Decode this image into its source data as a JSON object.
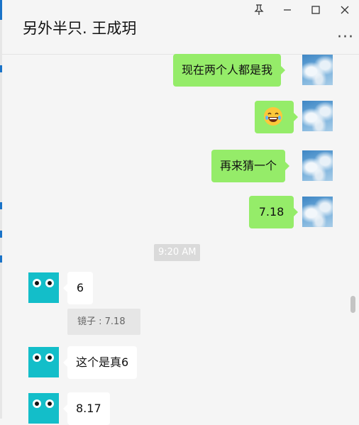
{
  "window": {
    "title": "另外半只. 王成玥",
    "more_label": "···"
  },
  "messages": [
    {
      "side": "right",
      "text": "现在两个人都是我"
    },
    {
      "side": "right",
      "emoji": "laughing-tears"
    },
    {
      "side": "right",
      "text": "再来猜一个"
    },
    {
      "side": "right",
      "text": "7.18"
    },
    {
      "side": "left",
      "text": "6"
    },
    {
      "side": "left",
      "text": "这个是真6"
    },
    {
      "side": "left",
      "text": "8.17"
    }
  ],
  "timestamp": "9:20 AM",
  "quote": {
    "text": "镜子 : 7.18"
  },
  "icons": {
    "pin": "pin-icon",
    "minimize": "minimize-icon",
    "maximize": "maximize-icon",
    "close": "close-icon",
    "more": "more-icon"
  },
  "colors": {
    "sent_bubble": "#95ec69",
    "received_bubble": "#ffffff",
    "avatar_teal": "#13bec9",
    "background": "#f5f5f5"
  }
}
